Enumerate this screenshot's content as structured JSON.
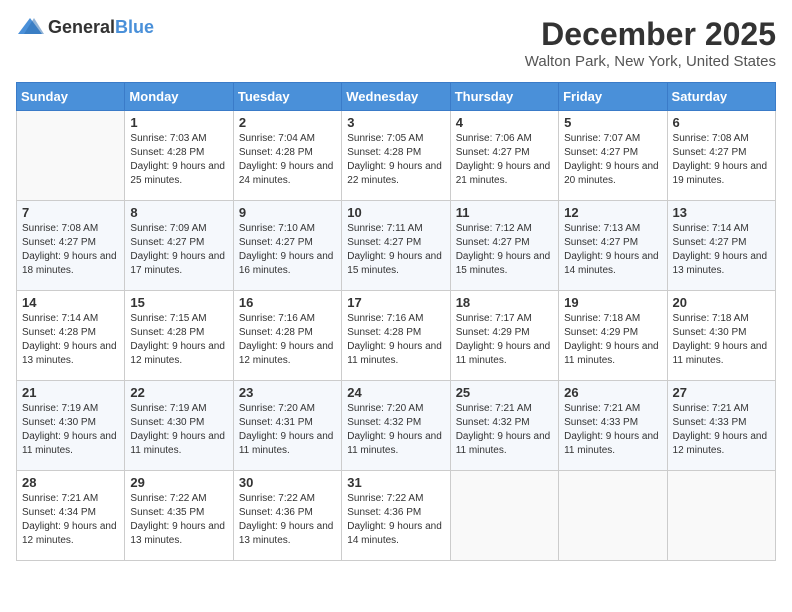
{
  "header": {
    "logo_general": "General",
    "logo_blue": "Blue",
    "month": "December 2025",
    "location": "Walton Park, New York, United States"
  },
  "days_of_week": [
    "Sunday",
    "Monday",
    "Tuesday",
    "Wednesday",
    "Thursday",
    "Friday",
    "Saturday"
  ],
  "weeks": [
    [
      {
        "day": "",
        "sunrise": "",
        "sunset": "",
        "daylight": ""
      },
      {
        "day": "1",
        "sunrise": "Sunrise: 7:03 AM",
        "sunset": "Sunset: 4:28 PM",
        "daylight": "Daylight: 9 hours and 25 minutes."
      },
      {
        "day": "2",
        "sunrise": "Sunrise: 7:04 AM",
        "sunset": "Sunset: 4:28 PM",
        "daylight": "Daylight: 9 hours and 24 minutes."
      },
      {
        "day": "3",
        "sunrise": "Sunrise: 7:05 AM",
        "sunset": "Sunset: 4:28 PM",
        "daylight": "Daylight: 9 hours and 22 minutes."
      },
      {
        "day": "4",
        "sunrise": "Sunrise: 7:06 AM",
        "sunset": "Sunset: 4:27 PM",
        "daylight": "Daylight: 9 hours and 21 minutes."
      },
      {
        "day": "5",
        "sunrise": "Sunrise: 7:07 AM",
        "sunset": "Sunset: 4:27 PM",
        "daylight": "Daylight: 9 hours and 20 minutes."
      },
      {
        "day": "6",
        "sunrise": "Sunrise: 7:08 AM",
        "sunset": "Sunset: 4:27 PM",
        "daylight": "Daylight: 9 hours and 19 minutes."
      }
    ],
    [
      {
        "day": "7",
        "sunrise": "Sunrise: 7:08 AM",
        "sunset": "Sunset: 4:27 PM",
        "daylight": "Daylight: 9 hours and 18 minutes."
      },
      {
        "day": "8",
        "sunrise": "Sunrise: 7:09 AM",
        "sunset": "Sunset: 4:27 PM",
        "daylight": "Daylight: 9 hours and 17 minutes."
      },
      {
        "day": "9",
        "sunrise": "Sunrise: 7:10 AM",
        "sunset": "Sunset: 4:27 PM",
        "daylight": "Daylight: 9 hours and 16 minutes."
      },
      {
        "day": "10",
        "sunrise": "Sunrise: 7:11 AM",
        "sunset": "Sunset: 4:27 PM",
        "daylight": "Daylight: 9 hours and 15 minutes."
      },
      {
        "day": "11",
        "sunrise": "Sunrise: 7:12 AM",
        "sunset": "Sunset: 4:27 PM",
        "daylight": "Daylight: 9 hours and 15 minutes."
      },
      {
        "day": "12",
        "sunrise": "Sunrise: 7:13 AM",
        "sunset": "Sunset: 4:27 PM",
        "daylight": "Daylight: 9 hours and 14 minutes."
      },
      {
        "day": "13",
        "sunrise": "Sunrise: 7:14 AM",
        "sunset": "Sunset: 4:27 PM",
        "daylight": "Daylight: 9 hours and 13 minutes."
      }
    ],
    [
      {
        "day": "14",
        "sunrise": "Sunrise: 7:14 AM",
        "sunset": "Sunset: 4:28 PM",
        "daylight": "Daylight: 9 hours and 13 minutes."
      },
      {
        "day": "15",
        "sunrise": "Sunrise: 7:15 AM",
        "sunset": "Sunset: 4:28 PM",
        "daylight": "Daylight: 9 hours and 12 minutes."
      },
      {
        "day": "16",
        "sunrise": "Sunrise: 7:16 AM",
        "sunset": "Sunset: 4:28 PM",
        "daylight": "Daylight: 9 hours and 12 minutes."
      },
      {
        "day": "17",
        "sunrise": "Sunrise: 7:16 AM",
        "sunset": "Sunset: 4:28 PM",
        "daylight": "Daylight: 9 hours and 11 minutes."
      },
      {
        "day": "18",
        "sunrise": "Sunrise: 7:17 AM",
        "sunset": "Sunset: 4:29 PM",
        "daylight": "Daylight: 9 hours and 11 minutes."
      },
      {
        "day": "19",
        "sunrise": "Sunrise: 7:18 AM",
        "sunset": "Sunset: 4:29 PM",
        "daylight": "Daylight: 9 hours and 11 minutes."
      },
      {
        "day": "20",
        "sunrise": "Sunrise: 7:18 AM",
        "sunset": "Sunset: 4:30 PM",
        "daylight": "Daylight: 9 hours and 11 minutes."
      }
    ],
    [
      {
        "day": "21",
        "sunrise": "Sunrise: 7:19 AM",
        "sunset": "Sunset: 4:30 PM",
        "daylight": "Daylight: 9 hours and 11 minutes."
      },
      {
        "day": "22",
        "sunrise": "Sunrise: 7:19 AM",
        "sunset": "Sunset: 4:30 PM",
        "daylight": "Daylight: 9 hours and 11 minutes."
      },
      {
        "day": "23",
        "sunrise": "Sunrise: 7:20 AM",
        "sunset": "Sunset: 4:31 PM",
        "daylight": "Daylight: 9 hours and 11 minutes."
      },
      {
        "day": "24",
        "sunrise": "Sunrise: 7:20 AM",
        "sunset": "Sunset: 4:32 PM",
        "daylight": "Daylight: 9 hours and 11 minutes."
      },
      {
        "day": "25",
        "sunrise": "Sunrise: 7:21 AM",
        "sunset": "Sunset: 4:32 PM",
        "daylight": "Daylight: 9 hours and 11 minutes."
      },
      {
        "day": "26",
        "sunrise": "Sunrise: 7:21 AM",
        "sunset": "Sunset: 4:33 PM",
        "daylight": "Daylight: 9 hours and 11 minutes."
      },
      {
        "day": "27",
        "sunrise": "Sunrise: 7:21 AM",
        "sunset": "Sunset: 4:33 PM",
        "daylight": "Daylight: 9 hours and 12 minutes."
      }
    ],
    [
      {
        "day": "28",
        "sunrise": "Sunrise: 7:21 AM",
        "sunset": "Sunset: 4:34 PM",
        "daylight": "Daylight: 9 hours and 12 minutes."
      },
      {
        "day": "29",
        "sunrise": "Sunrise: 7:22 AM",
        "sunset": "Sunset: 4:35 PM",
        "daylight": "Daylight: 9 hours and 13 minutes."
      },
      {
        "day": "30",
        "sunrise": "Sunrise: 7:22 AM",
        "sunset": "Sunset: 4:36 PM",
        "daylight": "Daylight: 9 hours and 13 minutes."
      },
      {
        "day": "31",
        "sunrise": "Sunrise: 7:22 AM",
        "sunset": "Sunset: 4:36 PM",
        "daylight": "Daylight: 9 hours and 14 minutes."
      },
      {
        "day": "",
        "sunrise": "",
        "sunset": "",
        "daylight": ""
      },
      {
        "day": "",
        "sunrise": "",
        "sunset": "",
        "daylight": ""
      },
      {
        "day": "",
        "sunrise": "",
        "sunset": "",
        "daylight": ""
      }
    ]
  ]
}
